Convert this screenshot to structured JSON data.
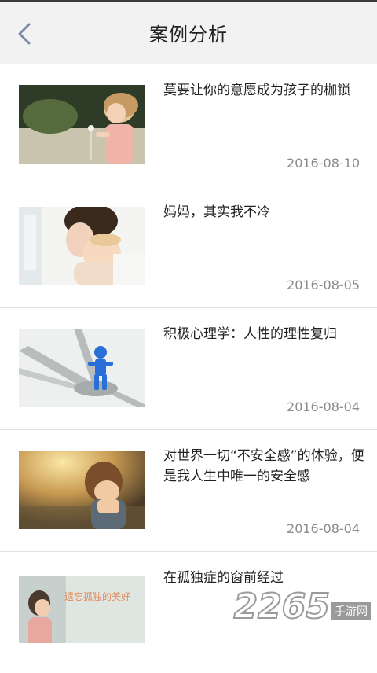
{
  "header": {
    "title": "案例分析",
    "back_icon": "chevron-left-icon"
  },
  "articles": [
    {
      "title": "莫要让你的意愿成为孩子的枷锁",
      "date": "2016-08-10",
      "thumb": "child-with-dandelion"
    },
    {
      "title": "妈妈，其实我不冷",
      "date": "2016-08-05",
      "thumb": "mother-and-baby"
    },
    {
      "title": "积极心理学：人性的理性复归",
      "date": "2016-08-04",
      "thumb": "blue-figure-crossroads"
    },
    {
      "title": "对世界一切“不安全感”的体验，便是我人生中唯一的安全感",
      "date": "2016-08-04",
      "thumb": "child-covering-face"
    },
    {
      "title": "在孤独症的窗前经过",
      "date": "",
      "thumb": "child-by-window",
      "thumb_text": "遗忘孤独的美好"
    }
  ],
  "watermark": {
    "number": "2265",
    "text": "手游网"
  },
  "colors": {
    "header_bg": "#f2f2f2",
    "back_icon": "#7a8aa8",
    "date": "#8a8a8a",
    "divider": "#e0e0e0"
  }
}
